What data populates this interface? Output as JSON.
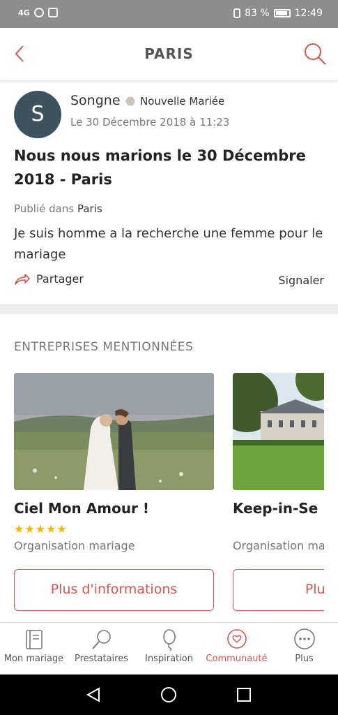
{
  "statusbar": {
    "left": "4G",
    "battery": "83 %",
    "time": "12:49"
  },
  "header": {
    "title": "PARIS"
  },
  "post": {
    "avatar_letter": "S",
    "author": "Songne",
    "badge": "Nouvelle Mariée",
    "date": "Le 30 Décembre 2018 à 11:23",
    "title": "Nous nous marions le 30 Décembre 2018 - Paris",
    "published_label": "Publié dans",
    "published_place": "Paris",
    "body": "Je suis homme a la recherche une femme pour le mariage",
    "share_label": "Partager",
    "report_label": "Signaler"
  },
  "mentioned": {
    "section_title": "ENTREPRISES MENTIONNÉES",
    "cards": [
      {
        "name": "Ciel Mon Amour !",
        "stars": "★★★★★",
        "category": "Organisation mariage",
        "button": "Plus d'informations"
      },
      {
        "name": "Keep-in-Se",
        "stars": "",
        "category": "Organisation ma",
        "button": "Plus d'in"
      }
    ]
  },
  "tabs": [
    {
      "label": "Mon mariage",
      "icon": "notebook-icon"
    },
    {
      "label": "Prestataires",
      "icon": "magnifier-icon"
    },
    {
      "label": "Inspiration",
      "icon": "balloon-icon"
    },
    {
      "label": "Communauté",
      "icon": "heart-chat-icon",
      "active": true
    },
    {
      "label": "Plus",
      "icon": "more-icon"
    }
  ],
  "colors": {
    "accent": "#d9534f",
    "avatar_bg": "#3e5360",
    "star": "#f4b400"
  }
}
